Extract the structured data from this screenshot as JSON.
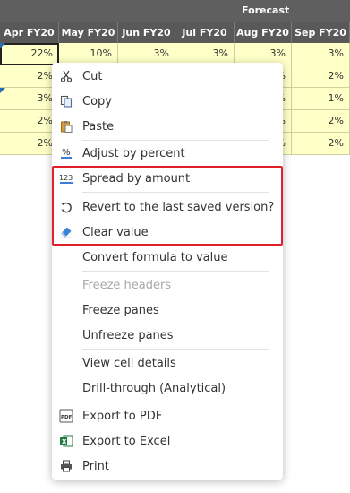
{
  "forecast_label": "Forecast",
  "columns": [
    "Apr FY20",
    "May FY20",
    "Jun FY20",
    "Jul FY20",
    "Aug FY20",
    "Sep FY20"
  ],
  "rows": [
    [
      "22%",
      "10%",
      "3%",
      "3%",
      "3%",
      "3%"
    ],
    [
      "2%",
      "",
      "",
      "",
      "%",
      "2%"
    ],
    [
      "3%",
      "",
      "",
      "",
      "%",
      "1%"
    ],
    [
      "2%",
      "",
      "",
      "",
      "%",
      "2%"
    ],
    [
      "2%",
      "",
      "",
      "",
      "%",
      "2%"
    ]
  ],
  "menu": {
    "cut": "Cut",
    "copy": "Copy",
    "paste": "Paste",
    "adjust_by_percent": "Adjust by percent",
    "spread_by_amount": "Spread by amount",
    "revert": "Revert to the last saved version?",
    "clear_value": "Clear value",
    "convert_formula": "Convert formula to value",
    "freeze_headers": "Freeze headers",
    "freeze_panes": "Freeze panes",
    "unfreeze_panes": "Unfreeze panes",
    "view_cell_details": "View cell details",
    "drill_through": "Drill-through (Analytical)",
    "export_pdf": "Export to PDF",
    "export_excel": "Export to Excel",
    "print": "Print"
  },
  "icons": {
    "spread_label": "123",
    "pdf_label": "PDF",
    "excel_label": "X"
  },
  "colors": {
    "header_bg": "#595959",
    "cell_bg": "#ffffc8",
    "highlight": "#e0202a"
  }
}
